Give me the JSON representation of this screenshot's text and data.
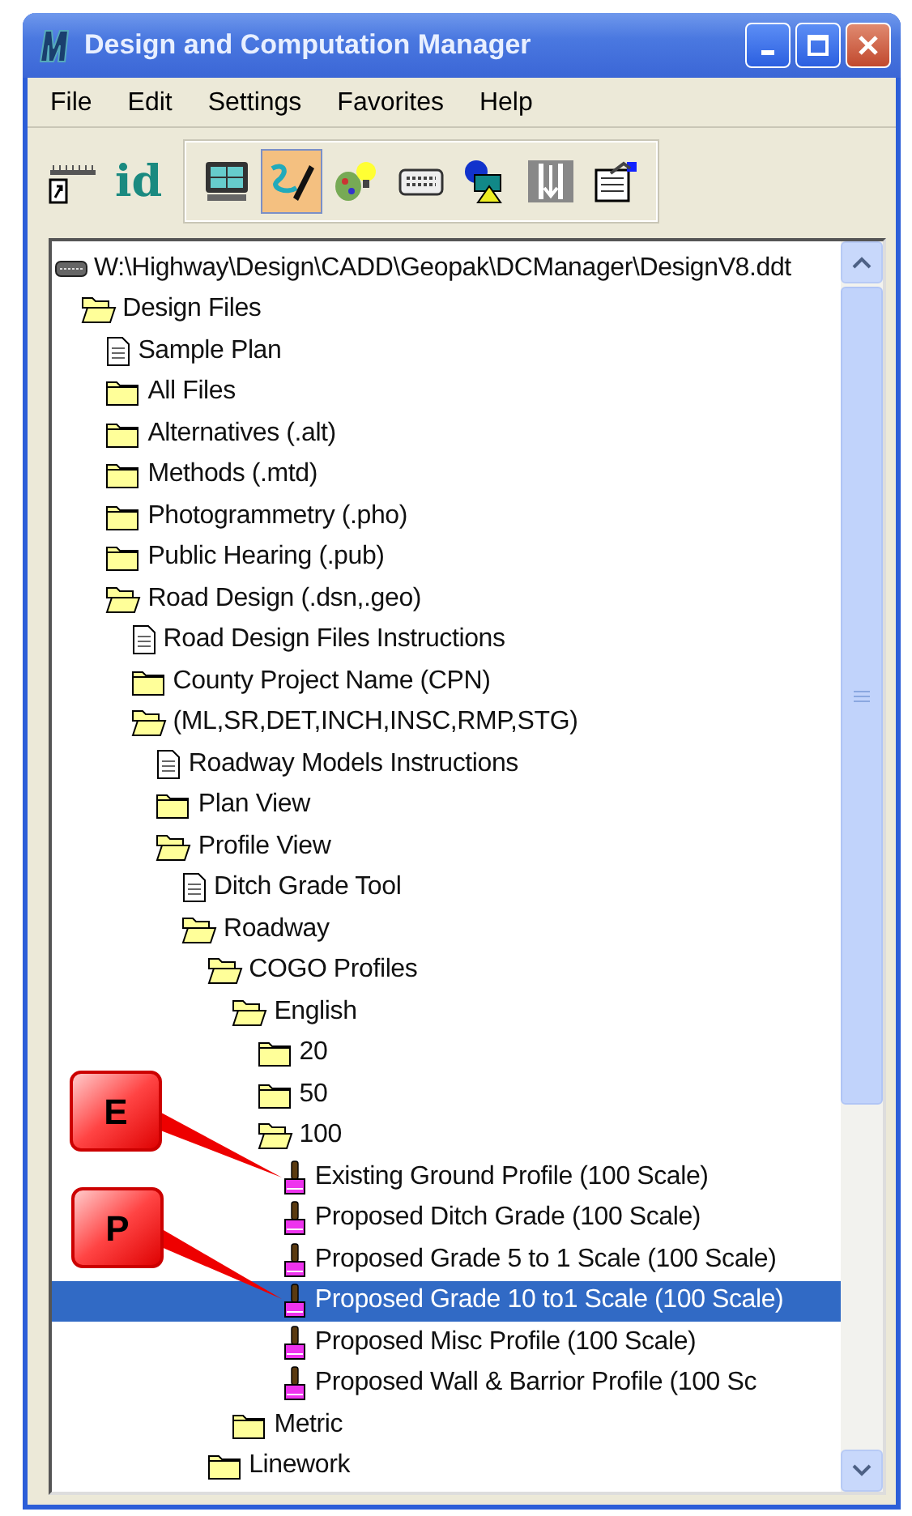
{
  "window": {
    "title": "Design and Computation Manager"
  },
  "menu": [
    "File",
    "Edit",
    "Settings",
    "Favorites",
    "Help"
  ],
  "toolbar": {
    "id_label": "id",
    "buttons": [
      {
        "selected": false
      },
      {
        "selected": true
      },
      {
        "selected": false
      },
      {
        "selected": false
      },
      {
        "selected": false
      },
      {
        "selected": false
      },
      {
        "selected": false
      }
    ]
  },
  "tree": [
    {
      "label": "W:\\Highway\\Design\\CADD\\Geopak\\DCManager\\DesignV8.ddt",
      "kind": "drive",
      "selected": false,
      "children": [
        {
          "label": "Design Files",
          "kind": "folder",
          "expanded": true,
          "selected": false,
          "children": [
            {
              "label": "Sample Plan",
              "kind": "document",
              "selected": false
            },
            {
              "label": "All Files",
              "kind": "folder",
              "expanded": false,
              "selected": false
            },
            {
              "label": "Alternatives (.alt)",
              "kind": "folder",
              "expanded": false,
              "selected": false
            },
            {
              "label": "Methods (.mtd)",
              "kind": "folder",
              "expanded": false,
              "selected": false
            },
            {
              "label": "Photogrammetry (.pho)",
              "kind": "folder",
              "expanded": false,
              "selected": false
            },
            {
              "label": "Public Hearing (.pub)",
              "kind": "folder",
              "expanded": false,
              "selected": false
            },
            {
              "label": "Road Design (.dsn,.geo)",
              "kind": "folder",
              "expanded": true,
              "selected": false,
              "children": [
                {
                  "label": "Road Design Files Instructions",
                  "kind": "document",
                  "selected": false
                },
                {
                  "label": "County Project Name (CPN)",
                  "kind": "folder",
                  "expanded": false,
                  "selected": false
                },
                {
                  "label": "(ML,SR,DET,INCH,INSC,RMP,STG)",
                  "kind": "folder",
                  "expanded": true,
                  "selected": false,
                  "children": [
                    {
                      "label": "Roadway Models Instructions",
                      "kind": "document",
                      "selected": false
                    },
                    {
                      "label": "Plan View",
                      "kind": "folder",
                      "expanded": false,
                      "selected": false
                    },
                    {
                      "label": "Profile View",
                      "kind": "folder",
                      "expanded": true,
                      "selected": false,
                      "children": [
                        {
                          "label": "Ditch Grade Tool",
                          "kind": "document",
                          "selected": false
                        },
                        {
                          "label": "Roadway",
                          "kind": "folder",
                          "expanded": true,
                          "selected": false,
                          "children": [
                            {
                              "label": "COGO Profiles",
                              "kind": "folder",
                              "expanded": true,
                              "selected": false,
                              "children": [
                                {
                                  "label": "English",
                                  "kind": "folder",
                                  "expanded": true,
                                  "selected": false,
                                  "children": [
                                    {
                                      "label": "20",
                                      "kind": "folder",
                                      "expanded": false,
                                      "selected": false
                                    },
                                    {
                                      "label": "50",
                                      "kind": "folder",
                                      "expanded": false,
                                      "selected": false
                                    },
                                    {
                                      "label": "100",
                                      "kind": "folder",
                                      "expanded": true,
                                      "selected": false,
                                      "children": [
                                        {
                                          "label": "Existing Ground Profile (100 Scale)",
                                          "kind": "profile",
                                          "selected": false
                                        },
                                        {
                                          "label": "Proposed Ditch Grade (100 Scale)",
                                          "kind": "profile",
                                          "selected": false
                                        },
                                        {
                                          "label": "Proposed Grade 5 to 1 Scale (100 Scale)",
                                          "kind": "profile",
                                          "selected": false
                                        },
                                        {
                                          "label": "Proposed Grade 10 to1 Scale (100 Scale)",
                                          "kind": "profile",
                                          "selected": true
                                        },
                                        {
                                          "label": "Proposed Misc Profile (100 Scale)",
                                          "kind": "profile",
                                          "selected": false
                                        },
                                        {
                                          "label": "Proposed Wall & Barrior Profile (100 Sc",
                                          "kind": "profile",
                                          "selected": false
                                        }
                                      ]
                                    }
                                  ]
                                },
                                {
                                  "label": "Metric",
                                  "kind": "folder",
                                  "expanded": false,
                                  "selected": false
                                }
                              ]
                            },
                            {
                              "label": "Linework",
                              "kind": "folder",
                              "expanded": false,
                              "selected": false
                            }
                          ]
                        }
                      ]
                    }
                  ]
                }
              ]
            }
          ]
        }
      ]
    }
  ],
  "callouts": [
    {
      "label": "E"
    },
    {
      "label": "P"
    }
  ]
}
